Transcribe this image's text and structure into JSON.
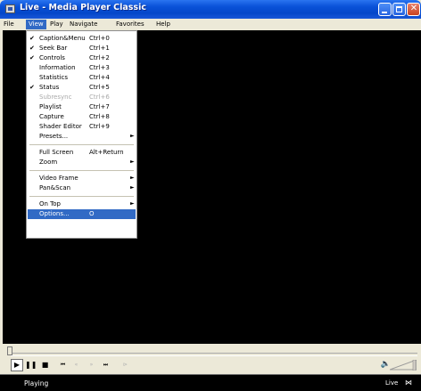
{
  "window": {
    "title": "Live - Media Player Classic",
    "buttons": {
      "minimize_icon": "minimize-icon",
      "maximize_icon": "maximize-icon",
      "close_glyph": "✕"
    }
  },
  "menubar": {
    "file": "File",
    "view": "View",
    "play": "Play",
    "navigate": "Navigate",
    "favorites": "Favorites",
    "help": "Help"
  },
  "view_menu": {
    "items": [
      {
        "label": "Caption&Menu",
        "shortcut": "Ctrl+0",
        "checked": true
      },
      {
        "label": "Seek Bar",
        "shortcut": "Ctrl+1",
        "checked": true
      },
      {
        "label": "Controls",
        "shortcut": "Ctrl+2",
        "checked": true
      },
      {
        "label": "Information",
        "shortcut": "Ctrl+3",
        "checked": false
      },
      {
        "label": "Statistics",
        "shortcut": "Ctrl+4",
        "checked": false
      },
      {
        "label": "Status",
        "shortcut": "Ctrl+5",
        "checked": true
      },
      {
        "label": "Subresync",
        "shortcut": "Ctrl+6",
        "checked": false,
        "disabled": true
      },
      {
        "label": "Playlist",
        "shortcut": "Ctrl+7",
        "checked": false
      },
      {
        "label": "Capture",
        "shortcut": "Ctrl+8",
        "checked": false
      },
      {
        "label": "Shader Editor",
        "shortcut": "Ctrl+9",
        "checked": false
      },
      {
        "label": "Presets...",
        "submenu": true
      },
      {
        "label": "Full Screen",
        "shortcut": "Alt+Return"
      },
      {
        "label": "Zoom",
        "submenu": true
      },
      {
        "label": "Video Frame",
        "submenu": true
      },
      {
        "label": "Pan&Scan",
        "submenu": true
      },
      {
        "label": "On Top",
        "submenu": true
      },
      {
        "label": "Options...",
        "shortcut": "O",
        "selected": true
      }
    ],
    "check_glyph": "✔",
    "submenu_glyph": "►"
  },
  "controls": {
    "play": "▶",
    "pause": "❚❚",
    "stop": "■",
    "prev": "⏮",
    "rewind": "«",
    "fast_forward": "»",
    "next": "⏭",
    "frame_step": "⊳",
    "volume_icon": "🔈"
  },
  "status": {
    "text": "Playing",
    "mode": "Live",
    "net_icon": "⋈"
  },
  "colors": {
    "title_bar": "#0A52D8",
    "highlight": "#316AC5",
    "video_background": "#000000",
    "chrome": "#ECE9D8"
  }
}
